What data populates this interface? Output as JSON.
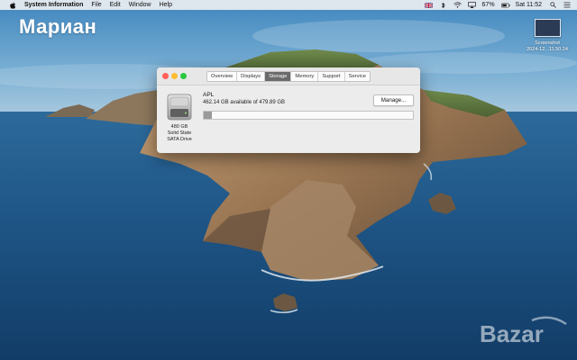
{
  "menubar": {
    "app_name": "System Information",
    "menus": [
      "File",
      "Edit",
      "Window",
      "Help"
    ],
    "battery": "67%",
    "clock": "Sat 11:52"
  },
  "desktop": {
    "title": "Мариан",
    "icon_label_line1": "Screenshot",
    "icon_label_line2": "2024-12...11.50.24"
  },
  "window": {
    "tabs": [
      "Overview",
      "Displays",
      "Storage",
      "Memory",
      "Support",
      "Service"
    ],
    "active_tab": "Storage",
    "drive": {
      "capacity": "480 GB",
      "type_line1": "Solid State",
      "type_line2": "SATA Drive",
      "name": "APL",
      "availability": "462.14 GB available of 479.89 GB",
      "used_fraction": 0.037
    },
    "manage_label": "Manage..."
  },
  "watermark": {
    "text": "Bazar"
  }
}
